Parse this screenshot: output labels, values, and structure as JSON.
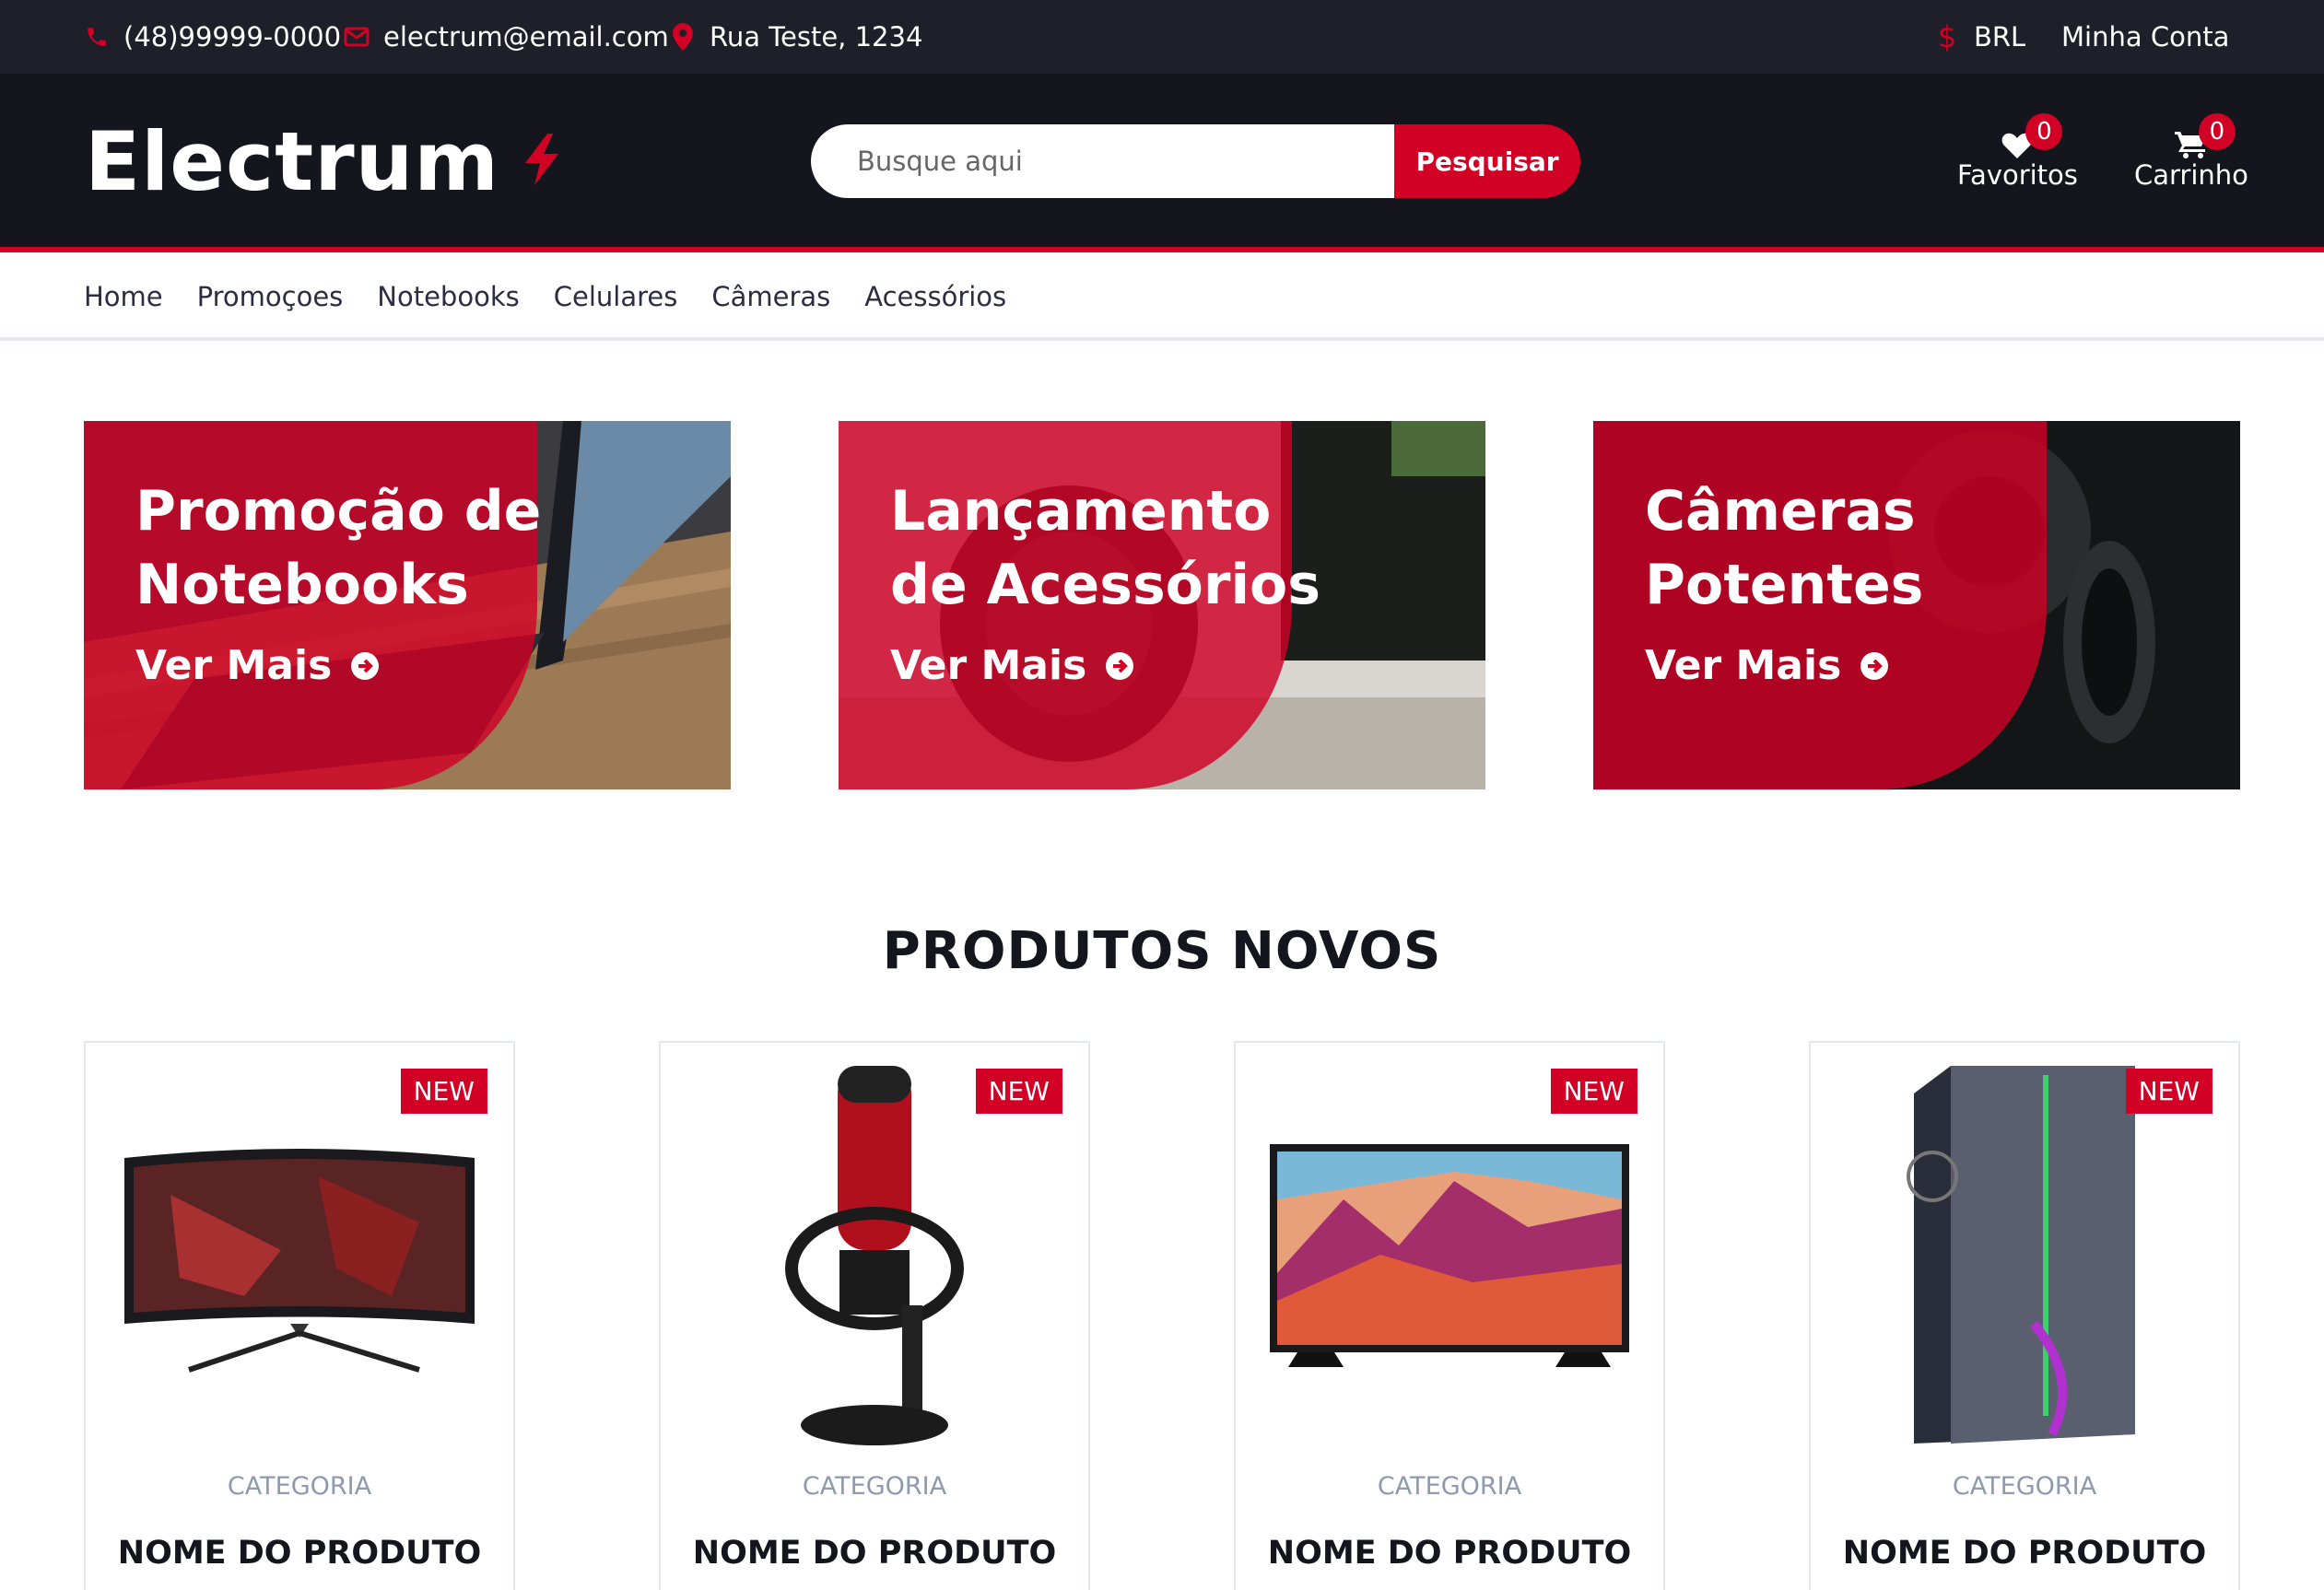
{
  "topbar": {
    "phone": "(48)99999-0000",
    "email": "electrum@email.com",
    "address": "Rua Teste, 1234",
    "currency": "BRL",
    "account": "Minha Conta"
  },
  "header": {
    "logo": "Electrum",
    "search_placeholder": "Busque aqui",
    "search_button": "Pesquisar",
    "favorites_label": "Favoritos",
    "favorites_count": "0",
    "cart_label": "Carrinho",
    "cart_count": "0"
  },
  "nav": {
    "items": [
      "Home",
      "Promoçoes",
      "Notebooks",
      "Celulares",
      "Câmeras",
      "Acessórios"
    ]
  },
  "banners": [
    {
      "line1": "Promoção de",
      "line2": "Notebooks",
      "cta": "Ver Mais"
    },
    {
      "line1": "Lançamento",
      "line2": "de Acessórios",
      "cta": "Ver Mais"
    },
    {
      "line1": "Câmeras",
      "line2": "Potentes",
      "cta": "Ver Mais"
    }
  ],
  "section_title": "PRODUTOS NOVOS",
  "products": [
    {
      "badge": "NEW",
      "category": "CATEGORIA",
      "name": "NOME DO PRODUTO",
      "image": "curved-monitor"
    },
    {
      "badge": "NEW",
      "category": "CATEGORIA",
      "name": "NOME DO PRODUTO",
      "image": "microphone"
    },
    {
      "badge": "NEW",
      "category": "CATEGORIA",
      "name": "NOME DO PRODUTO",
      "image": "television"
    },
    {
      "badge": "NEW",
      "category": "CATEGORIA",
      "name": "NOME DO PRODUTO",
      "image": "pc-case"
    }
  ],
  "colors": {
    "accent": "#d10024",
    "dark": "#15161d",
    "topbar": "#1e1f29"
  }
}
